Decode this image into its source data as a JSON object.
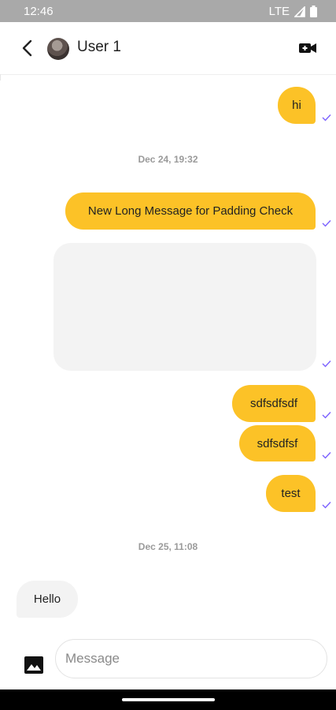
{
  "status_bar": {
    "time": "12:46",
    "network": "LTE"
  },
  "header": {
    "title": "User 1",
    "back_icon": "chevron-left-icon",
    "video_icon": "video-camera-plus-icon"
  },
  "colors": {
    "outgoing_bubble": "#fcc227",
    "incoming_bubble": "#f3f3f3",
    "read_check": "#7b61ff",
    "date_text": "#9a9a9a"
  },
  "messages": [
    {
      "text": "hi",
      "direction": "outgoing",
      "status": "sent"
    },
    {
      "date_divider": "Dec 24, 19:32"
    },
    {
      "text": "New Long Message for Padding Check",
      "direction": "outgoing",
      "status": "sent"
    },
    {
      "type": "image",
      "direction": "outgoing",
      "status": "sent"
    },
    {
      "text": "sdfsdfsdf",
      "direction": "outgoing",
      "status": "sent"
    },
    {
      "text": "sdfsdfsf",
      "direction": "outgoing",
      "status": "sent"
    },
    {
      "text": "test",
      "direction": "outgoing",
      "status": "sent"
    },
    {
      "date_divider": "Dec 25, 11:08"
    },
    {
      "text": "Hello",
      "direction": "incoming"
    }
  ],
  "composer": {
    "placeholder": "Message",
    "value": "",
    "attach_icon": "image-icon"
  }
}
